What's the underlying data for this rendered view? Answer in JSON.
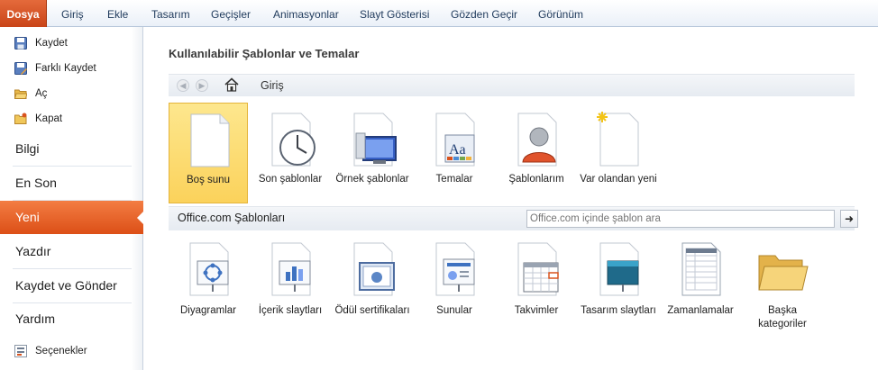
{
  "ribbon": {
    "file_tab": "Dosya",
    "tabs": [
      "Giriş",
      "Ekle",
      "Tasarım",
      "Geçişler",
      "Animasyonlar",
      "Slayt Gösterisi",
      "Gözden Geçir",
      "Görünüm"
    ]
  },
  "backstage": {
    "quick": [
      {
        "label": "Kaydet",
        "icon": "save-icon"
      },
      {
        "label": "Farklı Kaydet",
        "icon": "save-as-icon"
      },
      {
        "label": "Aç",
        "icon": "open-folder-icon"
      },
      {
        "label": "Kapat",
        "icon": "close-folder-icon"
      }
    ],
    "items": [
      "Bilgi",
      "En Son",
      "Yeni",
      "Yazdır",
      "Kaydet ve Gönder",
      "Yardım"
    ],
    "active_item": "Yeni",
    "options_label": "Seçenekler"
  },
  "main": {
    "heading": "Kullanılabilir Şablonlar ve Temalar",
    "nav_location": "Giriş",
    "available": [
      {
        "label": "Boş sunu",
        "icon": "blank-document-icon",
        "selected": true
      },
      {
        "label": "Son şablonlar",
        "icon": "clock-icon"
      },
      {
        "label": "Örnek şablonlar",
        "icon": "monitor-icon"
      },
      {
        "label": "Temalar",
        "icon": "theme-icon"
      },
      {
        "label": "Şablonlarım",
        "icon": "user-icon"
      },
      {
        "label": "Var olandan yeni",
        "icon": "new-from-existing-icon"
      }
    ],
    "office": {
      "label": "Office.com Şablonları",
      "search_placeholder": "Office.com içinde şablon ara",
      "items": [
        {
          "label": "Diyagramlar",
          "icon": "diagram-icon"
        },
        {
          "label": "İçerik slaytları",
          "icon": "content-slide-icon"
        },
        {
          "label": "Ödül sertifikaları",
          "icon": "certificate-icon"
        },
        {
          "label": "Sunular",
          "icon": "presentation-icon"
        },
        {
          "label": "Takvimler",
          "icon": "calendar-icon"
        },
        {
          "label": "Tasarım slaytları",
          "icon": "design-slide-icon"
        },
        {
          "label": "Zamanlamalar",
          "icon": "schedule-icon"
        },
        {
          "label": "Başka kategoriler",
          "icon": "folder-icon"
        }
      ]
    }
  },
  "colors": {
    "accent": "#d9531e",
    "selected_tile": "#fbd25b",
    "tab_text": "#1e395b"
  }
}
